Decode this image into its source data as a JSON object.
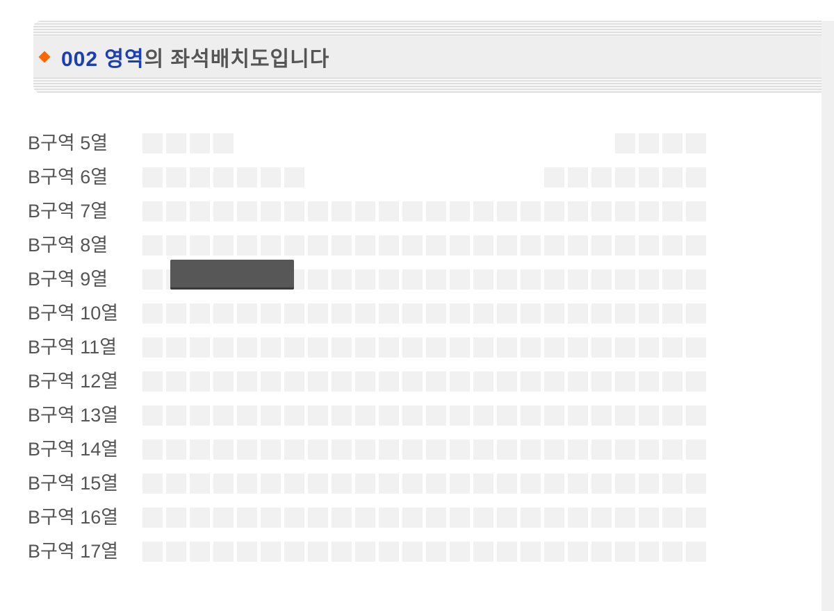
{
  "header": {
    "area_number": "002",
    "area_word": "영역",
    "suffix": "의 좌석배치도입니다"
  },
  "seat_section": "B구역",
  "row_word": "열",
  "rows": [
    {
      "num": 5,
      "left_seats": 4,
      "gap": 16,
      "right_seats": 4
    },
    {
      "num": 6,
      "left_seats": 7,
      "gap": 10,
      "right_seats": 7
    },
    {
      "num": 7,
      "left_seats": 24,
      "gap": 0,
      "right_seats": 0
    },
    {
      "num": 8,
      "left_seats": 24,
      "gap": 0,
      "right_seats": 0
    },
    {
      "num": 9,
      "left_seats": 24,
      "gap": 0,
      "right_seats": 0
    },
    {
      "num": 10,
      "left_seats": 24,
      "gap": 0,
      "right_seats": 0
    },
    {
      "num": 11,
      "left_seats": 24,
      "gap": 0,
      "right_seats": 0
    },
    {
      "num": 12,
      "left_seats": 24,
      "gap": 0,
      "right_seats": 0
    },
    {
      "num": 13,
      "left_seats": 24,
      "gap": 0,
      "right_seats": 0
    },
    {
      "num": 14,
      "left_seats": 24,
      "gap": 0,
      "right_seats": 0
    },
    {
      "num": 15,
      "left_seats": 24,
      "gap": 0,
      "right_seats": 0
    },
    {
      "num": 16,
      "left_seats": 24,
      "gap": 0,
      "right_seats": 0
    },
    {
      "num": 17,
      "left_seats": 24,
      "gap": 0,
      "right_seats": 0
    }
  ]
}
